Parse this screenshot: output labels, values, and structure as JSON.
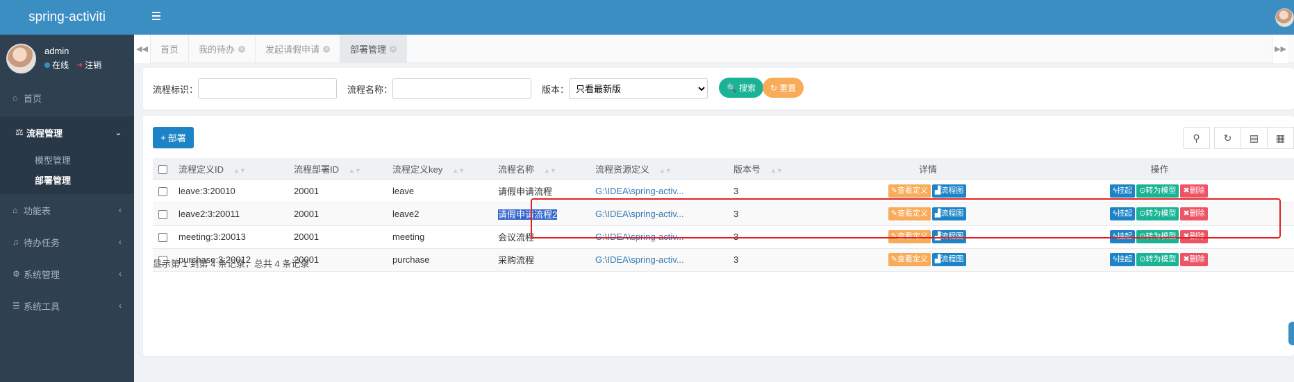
{
  "app": {
    "brand": "spring-activiti"
  },
  "user": {
    "name": "admin",
    "status": "在线",
    "logout": "注销"
  },
  "sidebar": {
    "home": "首页",
    "process_mgmt": {
      "label": "流程管理",
      "children": [
        "模型管理",
        "部署管理"
      ]
    },
    "items": [
      "功能表",
      "待办任务",
      "系统管理",
      "系统工具"
    ]
  },
  "tabs": [
    "首页",
    "我的待办",
    "发起请假申请",
    "部署管理"
  ],
  "search": {
    "key_label": "流程标识：",
    "name_label": "流程名称：",
    "version_label": "版本：",
    "version_value": "只看最新版",
    "search_btn": "搜索",
    "reset_btn": "重置"
  },
  "main": {
    "deploy_btn": "部署"
  },
  "table": {
    "columns": [
      "流程定义ID",
      "流程部署ID",
      "流程定义key",
      "流程名称",
      "流程资源定义",
      "版本号",
      "详情",
      "操作"
    ],
    "rows": [
      {
        "id": "leave:3:20010",
        "deploy_id": "20001",
        "key": "leave",
        "name": "请假申请流程",
        "resource": "G:\\IDEA\\spring-activ...",
        "version": "3"
      },
      {
        "id": "leave2:3:20011",
        "deploy_id": "20001",
        "key": "leave2",
        "name": "请假申请流程2",
        "resource": "G:\\IDEA\\spring-activ...",
        "version": "3"
      },
      {
        "id": "meeting:3:20013",
        "deploy_id": "20001",
        "key": "meeting",
        "name": "会议流程",
        "resource": "G:\\IDEA\\spring-activ...",
        "version": "3"
      },
      {
        "id": "purchase:3:20012",
        "deploy_id": "20001",
        "key": "purchase",
        "name": "采购流程",
        "resource": "G:\\IDEA\\spring-activ...",
        "version": "3"
      }
    ],
    "actions": {
      "view": "查看定义",
      "chart": "流程图",
      "suspend": "挂起",
      "to_model": "转为模型",
      "delete": "删除"
    }
  },
  "pager": {
    "text": "显示第 1 到第 4 条记录，总共 4 条记录"
  },
  "colors": {
    "primary": "#3a8ec2",
    "sidebar": "#2f4050",
    "success": "#1ab394",
    "warning": "#f8ac59",
    "danger": "#ed5565",
    "highlight_box": "#e02020"
  }
}
